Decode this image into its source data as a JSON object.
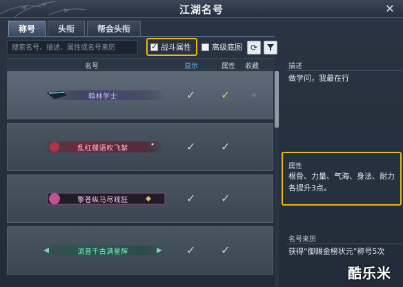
{
  "window": {
    "title": "江湖名号",
    "close_glyph": "✕"
  },
  "tabs": [
    {
      "label": "称号",
      "active": true
    },
    {
      "label": "头衔",
      "active": false
    },
    {
      "label": "帮会头衔",
      "active": false
    }
  ],
  "search": {
    "placeholder": "搜索名号、描述、属性或名号来历"
  },
  "filters": {
    "combat_attr": {
      "label": "战斗属性",
      "checked": true
    },
    "advanced_bg": {
      "label": "高级底图",
      "checked": false
    }
  },
  "toolbar": {
    "refresh_icon": "refresh-icon",
    "filter_icon": "filter-icon"
  },
  "table": {
    "headers": {
      "name": "名号",
      "show": "显示",
      "attr": "属性",
      "fav": "收藏"
    },
    "rows": [
      {
        "title": "翰林学士",
        "show": true,
        "attr": true,
        "attr_highlight": true,
        "favorite_icon": "star-icon"
      },
      {
        "title": "乱红蝶语吹飞絮",
        "show": true,
        "attr": true,
        "attr_highlight": false
      },
      {
        "title": "擎苍纵马尽疏狂",
        "show": true,
        "attr": true,
        "attr_highlight": false
      },
      {
        "title": "流音千古满星辉",
        "show": true,
        "attr": true,
        "attr_highlight": false
      }
    ]
  },
  "detail": {
    "description": {
      "title": "描述",
      "text": "做学问，我最在行"
    },
    "attributes": {
      "title": "属性",
      "text": "根骨、力量、气海、身法、耐力各提升3点。"
    },
    "origin": {
      "title": "名号来历",
      "text": "获得“御赐金榜状元”称号5次"
    }
  },
  "watermark": "酷乐米",
  "colors": {
    "highlight": "#e5b91c",
    "show_header": "#67b7ff",
    "gold_check": "#e8cd52"
  }
}
